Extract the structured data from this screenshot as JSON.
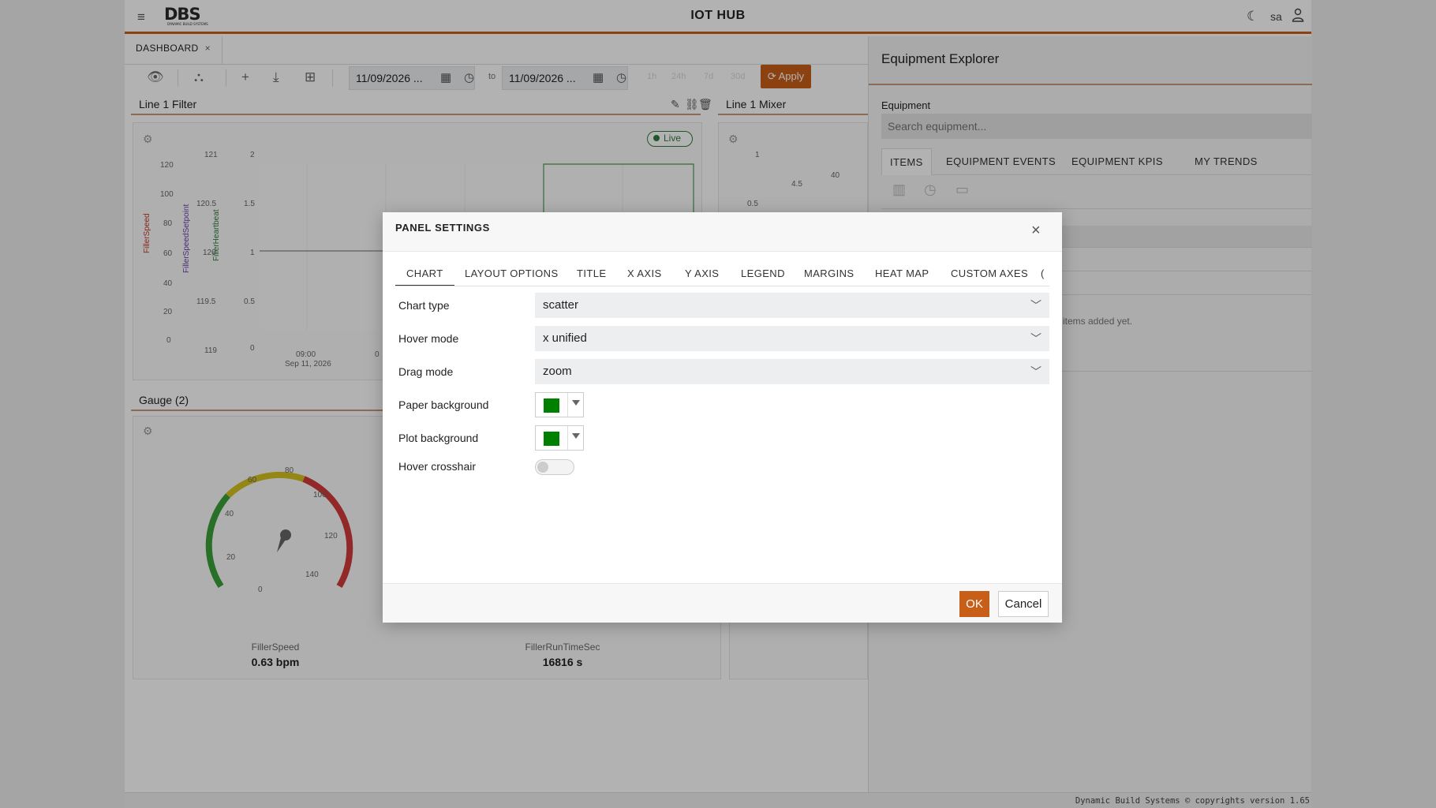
{
  "header": {
    "title": "IOT HUB",
    "user": "sa",
    "logo_text": "DBS",
    "logo_sub": "DYNAMIC BUILD SYSTEMS"
  },
  "tabs": [
    {
      "label": "DASHBOARD",
      "close": "×"
    }
  ],
  "toolbar": {
    "from_date": "11/09/2026 ...",
    "to_label": "to",
    "to_date": "11/09/2026 ...",
    "apply_label": "Apply",
    "faded_ranges": [
      "1h",
      "24h",
      "7d",
      "30d"
    ]
  },
  "panels": {
    "filter": {
      "title": "Line 1 Filter",
      "live_label": "Live",
      "axis_titles": [
        "FillerSpeed",
        "FillerSpeedSetpoint",
        "FillerHeartbeat"
      ],
      "ticks_a": [
        "120",
        "100",
        "80",
        "60",
        "40",
        "20",
        "0"
      ],
      "ticks_b": [
        "121",
        "120.5",
        "120",
        "119.5",
        "119"
      ],
      "ticks_c": [
        "2",
        "1.5",
        "1",
        "0.5",
        "0"
      ],
      "x_tick": "09:00",
      "x_date": "Sep 11, 2026",
      "x_tick2": "0"
    },
    "mixer": {
      "title": "Line 1 Mixer",
      "ticks_a": [
        "1",
        "0.5"
      ],
      "ticks_b": [
        "4.5"
      ],
      "ticks_c": [
        "40"
      ]
    },
    "gauge": {
      "title": "Gauge (2)",
      "gauge_ticks": [
        "0",
        "20",
        "40",
        "60",
        "80",
        "100",
        "120",
        "140"
      ],
      "g1_name": "FillerSpeed",
      "g1_value": "0.63 bpm",
      "g2_name": "FillerRunTimeSec",
      "g2_value": "16816 s"
    }
  },
  "explorer": {
    "title": "Equipment Explorer",
    "equipment_label": "Equipment",
    "search_placeholder": "Search equipment...",
    "tabs": [
      "ITEMS",
      "EQUIPMENT EVENTS",
      "EQUIPMENT KPIS",
      "MY TRENDS"
    ],
    "empty_text": "items added yet."
  },
  "footer": {
    "text": "Dynamic Build Systems © copyrights version 1.65"
  },
  "dialog": {
    "title": "PANEL SETTINGS",
    "close": "×",
    "tabs": [
      "CHART",
      "LAYOUT OPTIONS",
      "TITLE",
      "X AXIS",
      "Y AXIS",
      "LEGEND",
      "MARGINS",
      "HEAT MAP",
      "CUSTOM AXES",
      "("
    ],
    "fields": {
      "chart_type": {
        "label": "Chart type",
        "value": "scatter"
      },
      "hover_mode": {
        "label": "Hover mode",
        "value": "x unified"
      },
      "drag_mode": {
        "label": "Drag mode",
        "value": "zoom"
      },
      "paper_bg": {
        "label": "Paper background",
        "color": "#008000"
      },
      "plot_bg": {
        "label": "Plot background",
        "color": "#008000"
      },
      "hover_crosshair": {
        "label": "Hover crosshair",
        "enabled": false
      }
    },
    "ok_label": "OK",
    "cancel_label": "Cancel"
  },
  "colors": {
    "accent": "#c75f18",
    "live": "#2d7d3c",
    "overlay": "rgba(0,0,0,0.30)"
  }
}
